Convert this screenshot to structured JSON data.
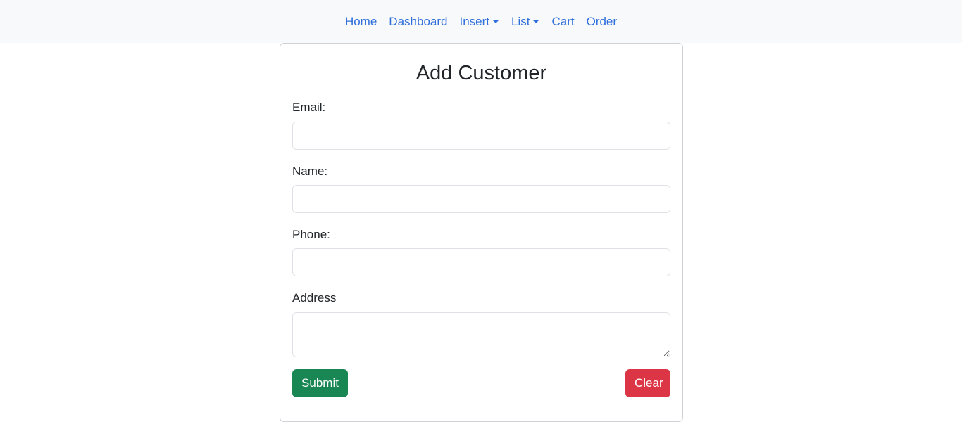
{
  "navbar": {
    "items": [
      {
        "label": "Home",
        "dropdown": false
      },
      {
        "label": "Dashboard",
        "dropdown": false
      },
      {
        "label": "Insert",
        "dropdown": true
      },
      {
        "label": "List",
        "dropdown": true
      },
      {
        "label": "Cart",
        "dropdown": false
      },
      {
        "label": "Order",
        "dropdown": false
      }
    ],
    "link_color": "#2f6fdb",
    "background": "#f8f9fa"
  },
  "form": {
    "title": "Add Customer",
    "email": {
      "label": "Email:",
      "value": ""
    },
    "name": {
      "label": "Name:",
      "value": ""
    },
    "phone": {
      "label": "Phone:",
      "value": ""
    },
    "address": {
      "label": "Address",
      "value": ""
    },
    "submit_label": "Submit",
    "clear_label": "Clear",
    "submit_color": "#198754",
    "clear_color": "#dc3545"
  }
}
